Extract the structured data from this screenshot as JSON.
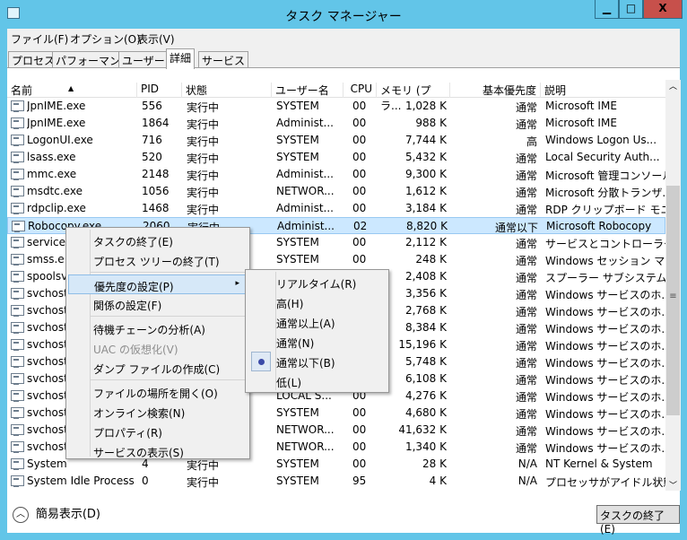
{
  "window": {
    "title": "タスク マネージャー",
    "minimize": "▁",
    "maximize": "□",
    "close": "X"
  },
  "menubar": [
    "ファイル(F)",
    "オプション(O)",
    "表示(V)"
  ],
  "tabs": [
    {
      "label": "プロセス"
    },
    {
      "label": "パフォーマンス"
    },
    {
      "label": "ユーザー"
    },
    {
      "label": "詳細",
      "active": true
    },
    {
      "label": "サービス"
    }
  ],
  "columns": [
    "名前",
    "PID",
    "状態",
    "ユーザー名",
    "CPU",
    "メモリ (プラ...",
    "基本優先度",
    "説明"
  ],
  "sort": {
    "column": "名前",
    "direction": "ascending"
  },
  "rows": [
    {
      "name": "JpnIME.exe",
      "pid": "556",
      "status": "実行中",
      "user": "SYSTEM",
      "cpu": "00",
      "mem": "1,028 K",
      "prio": "通常",
      "desc": "Microsoft IME"
    },
    {
      "name": "JpnIME.exe",
      "pid": "1864",
      "status": "実行中",
      "user": "Administ...",
      "cpu": "00",
      "mem": "988 K",
      "prio": "通常",
      "desc": "Microsoft IME"
    },
    {
      "name": "LogonUI.exe",
      "pid": "716",
      "status": "実行中",
      "user": "SYSTEM",
      "cpu": "00",
      "mem": "7,744 K",
      "prio": "高",
      "desc": "Windows Logon Us..."
    },
    {
      "name": "lsass.exe",
      "pid": "520",
      "status": "実行中",
      "user": "SYSTEM",
      "cpu": "00",
      "mem": "5,432 K",
      "prio": "通常",
      "desc": "Local Security Auth..."
    },
    {
      "name": "mmc.exe",
      "pid": "2148",
      "status": "実行中",
      "user": "Administ...",
      "cpu": "00",
      "mem": "9,300 K",
      "prio": "通常",
      "desc": "Microsoft 管理コンソール"
    },
    {
      "name": "msdtc.exe",
      "pid": "1056",
      "status": "実行中",
      "user": "NETWOR...",
      "cpu": "00",
      "mem": "1,612 K",
      "prio": "通常",
      "desc": "Microsoft 分散トランザ..."
    },
    {
      "name": "rdpclip.exe",
      "pid": "1468",
      "status": "実行中",
      "user": "Administ...",
      "cpu": "00",
      "mem": "3,184 K",
      "prio": "通常",
      "desc": "RDP クリップボード モニター"
    },
    {
      "name": "Robocopy.exe",
      "pid": "2060",
      "status": "実行中",
      "user": "Administ...",
      "cpu": "02",
      "mem": "8,820 K",
      "prio": "通常以下",
      "desc": "Microsoft Robocopy",
      "selected": true
    },
    {
      "name": "services",
      "user": "SYSTEM",
      "cpu": "00",
      "mem": "2,112 K",
      "prio": "通常",
      "desc": "サービスとコントローラー ..."
    },
    {
      "name": "smss.e",
      "user": "SYSTEM",
      "cpu": "00",
      "mem": "248 K",
      "prio": "通常",
      "desc": "Windows セッション マ..."
    },
    {
      "name": "spoolsv",
      "mem": "2,408 K",
      "prio": "通常",
      "desc": "スプーラー サブシステム ..."
    },
    {
      "name": "svchost",
      "mem": "3,356 K",
      "prio": "通常",
      "desc": "Windows サービスのホ..."
    },
    {
      "name": "svchost",
      "mem": "2,768 K",
      "prio": "通常",
      "desc": "Windows サービスのホ..."
    },
    {
      "name": "svchost",
      "mem": "8,384 K",
      "prio": "通常",
      "desc": "Windows サービスのホ..."
    },
    {
      "name": "svchost",
      "mem": "15,196 K",
      "prio": "通常",
      "desc": "Windows サービスのホ..."
    },
    {
      "name": "svchost",
      "mem": "5,748 K",
      "prio": "通常",
      "desc": "Windows サービスのホ..."
    },
    {
      "name": "svchost",
      "mem": "6,108 K",
      "prio": "通常",
      "desc": "Windows サービスのホ..."
    },
    {
      "name": "svchost",
      "user": "LOCAL S...",
      "cpu": "00",
      "mem": "4,276 K",
      "prio": "通常",
      "desc": "Windows サービスのホ..."
    },
    {
      "name": "svchost",
      "user": "SYSTEM",
      "cpu": "00",
      "mem": "4,680 K",
      "prio": "通常",
      "desc": "Windows サービスのホ..."
    },
    {
      "name": "svchost",
      "user": "NETWOR...",
      "cpu": "00",
      "mem": "41,632 K",
      "prio": "通常",
      "desc": "Windows サービスのホ..."
    },
    {
      "name": "svchost",
      "user": "NETWOR...",
      "cpu": "00",
      "mem": "1,340 K",
      "prio": "通常",
      "desc": "Windows サービスのホ..."
    },
    {
      "name": "System",
      "pid": "4",
      "status": "実行中",
      "user": "SYSTEM",
      "cpu": "00",
      "mem": "28 K",
      "prio": "N/A",
      "desc": "NT Kernel & System"
    },
    {
      "name": "System Idle Process",
      "pid": "0",
      "status": "実行中",
      "user": "SYSTEM",
      "cpu": "95",
      "mem": "4 K",
      "prio": "N/A",
      "desc": "プロセッサがアイドル状態..."
    }
  ],
  "context_menu": [
    {
      "label": "タスクの終了(E)"
    },
    {
      "label": "プロセス ツリーの終了(T)"
    },
    {
      "sep": true
    },
    {
      "label": "優先度の設定(P)",
      "submenu": true,
      "highlighted": true
    },
    {
      "label": "関係の設定(F)"
    },
    {
      "sep": true
    },
    {
      "label": "待機チェーンの分析(A)"
    },
    {
      "label": "UAC の仮想化(V)",
      "disabled": true
    },
    {
      "label": "ダンプ ファイルの作成(C)"
    },
    {
      "sep": true
    },
    {
      "label": "ファイルの場所を開く(O)"
    },
    {
      "label": "オンライン検索(N)"
    },
    {
      "label": "プロパティ(R)"
    },
    {
      "label": "サービスの表示(S)"
    }
  ],
  "priority_submenu": [
    {
      "label": "リアルタイム(R)"
    },
    {
      "label": "高(H)"
    },
    {
      "label": "通常以上(A)"
    },
    {
      "label": "通常(N)"
    },
    {
      "label": "通常以下(B)",
      "checked": true
    },
    {
      "label": "低(L)"
    }
  ],
  "footer": {
    "fewer_details": "簡易表示(D)",
    "end_task": "タスクの終了(E)"
  }
}
